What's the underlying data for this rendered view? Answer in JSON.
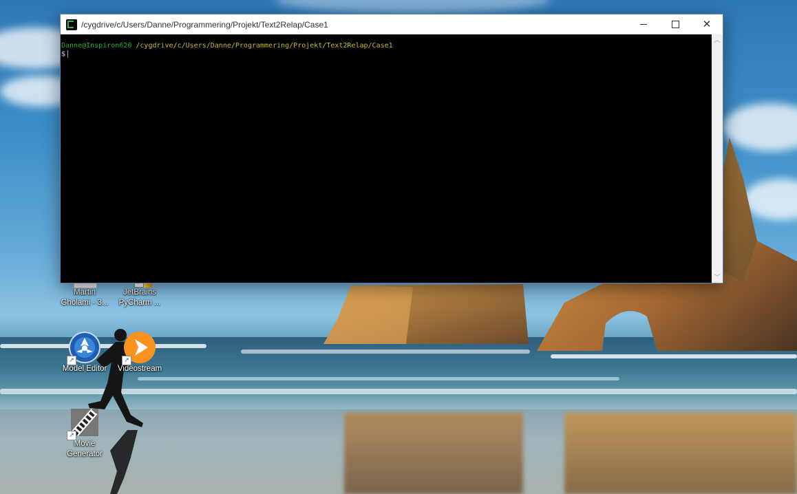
{
  "window": {
    "title": "/cygdrive/c/Users/Danne/Programmering/Projekt/Text2Relap/Case1",
    "minimize_glyph": "",
    "maximize_glyph": "",
    "close_glyph": "✕"
  },
  "terminal": {
    "prompt_user": "Danne@Inspiron620",
    "prompt_path": "/cygdrive/c/Users/Danne/Programmering/Projekt/Text2Relap/Case1",
    "prompt_symbol": "$"
  },
  "scrollbar": {
    "up_glyph": "︿",
    "down_glyph": "﹀"
  },
  "desktop_icons": [
    {
      "label_line1": "Martin",
      "label_line2": "Gholami - 3...",
      "icon": "document-icon"
    },
    {
      "label_line1": "JetBrains",
      "label_line2": "PyCharm ...",
      "icon": "pycharm-icon"
    },
    {
      "label_line1": "Model Editor",
      "label_line2": "",
      "icon": "model-editor-icon"
    },
    {
      "label_line1": "Videostream",
      "label_line2": "",
      "icon": "videostream-icon"
    },
    {
      "label_line1": "Movie",
      "label_line2": "Generator",
      "icon": "movie-generator-icon"
    }
  ],
  "colors": {
    "prompt_user": "#27ae32",
    "prompt_path": "#c6b92d",
    "window_border": "#5e84b4",
    "videostream_orange": "#f7931e"
  }
}
